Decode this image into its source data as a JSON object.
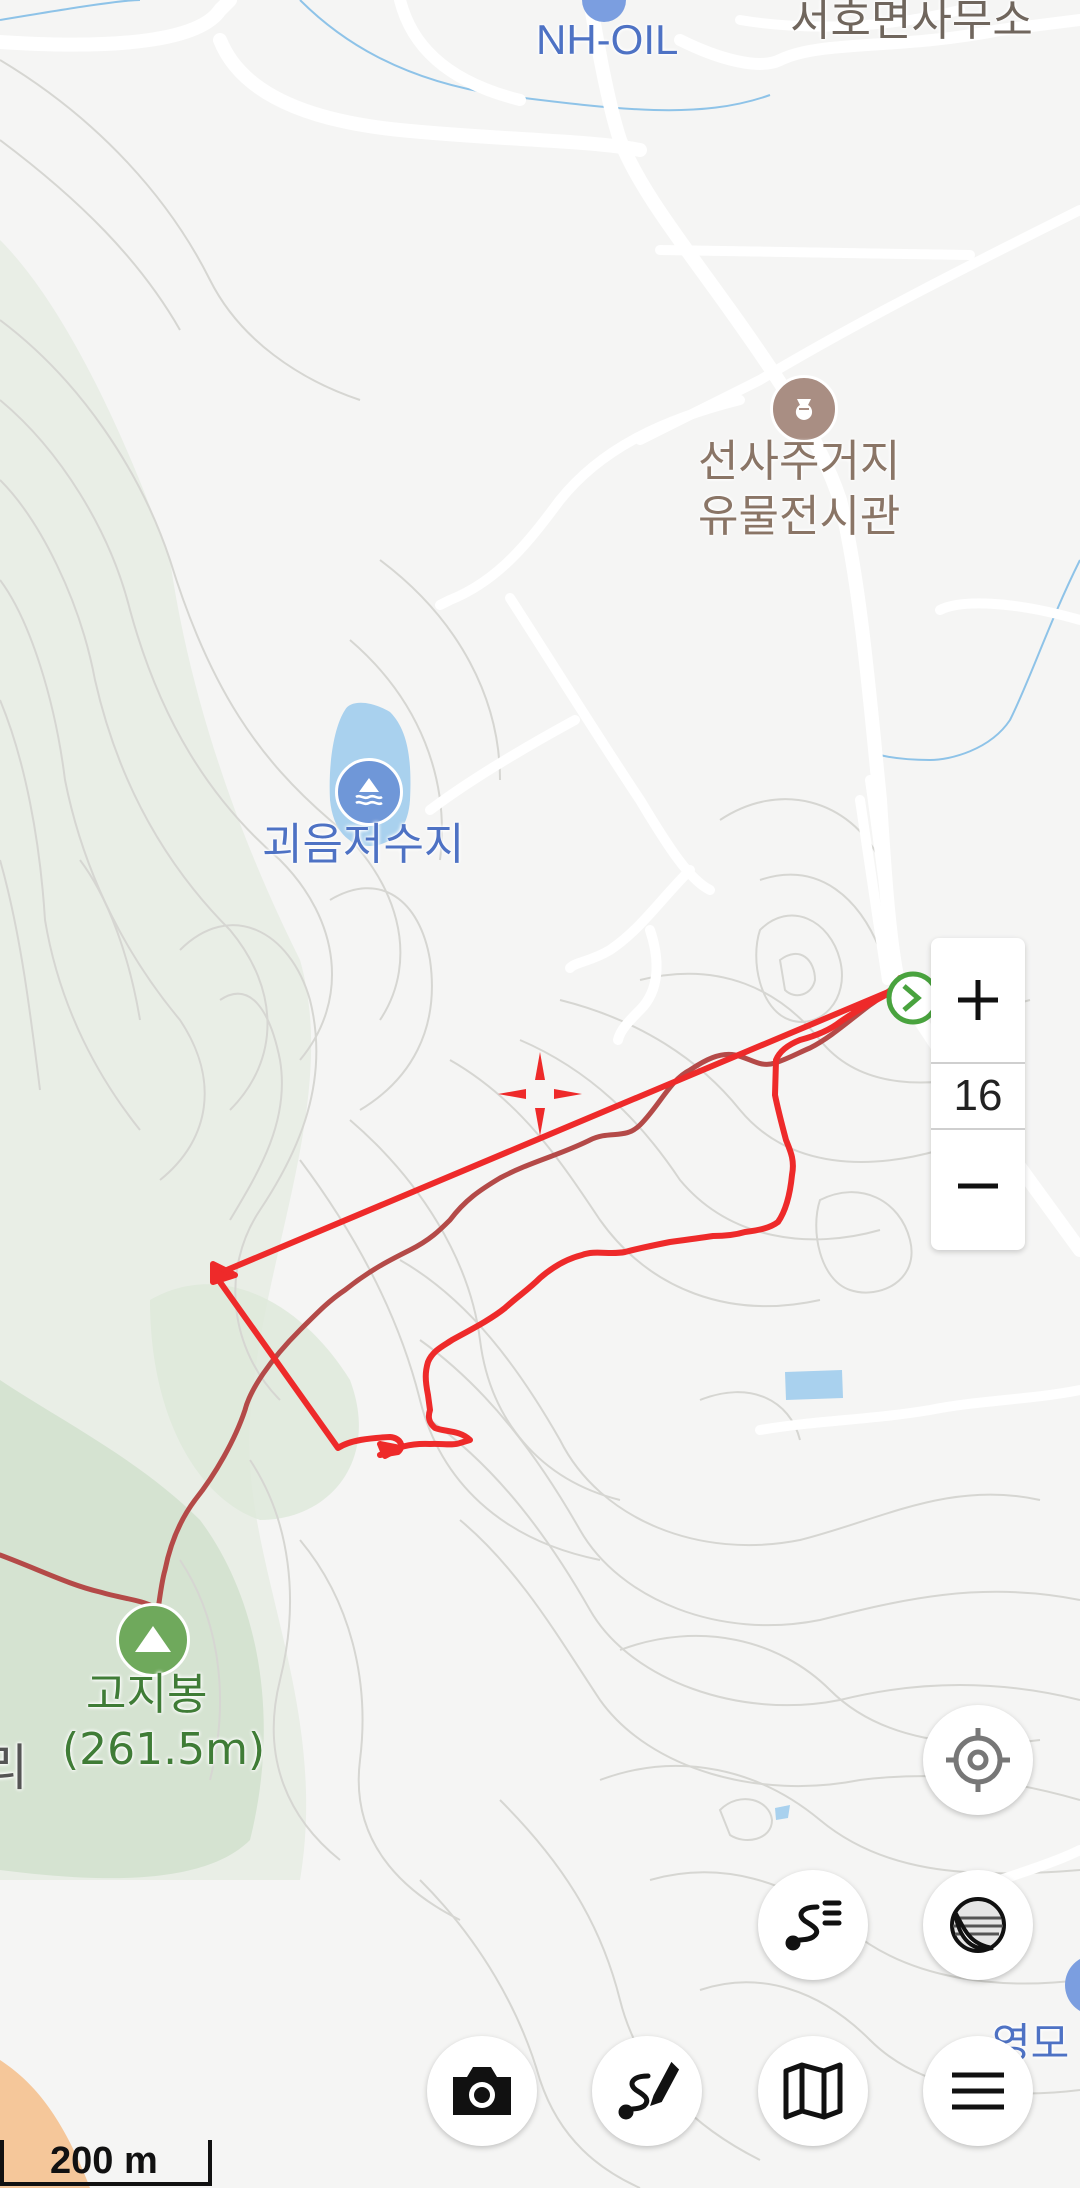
{
  "map": {
    "zoom_level": "16",
    "scale_label": "200 m",
    "route_color": "#ee2a2a",
    "trail_color": "#b44a48",
    "labels": {
      "gas_station": "NH-OIL",
      "town_office": "서호면사무소",
      "museum_line1": "선사주거지",
      "museum_line2": "유물전시관",
      "reservoir": "괴음저수지",
      "peak_name": "고지봉",
      "peak_elevation": "(261.5m)",
      "left_edge_partial": "리",
      "right_edge_partial": "영모"
    },
    "icons": {
      "museum": "museum-icon",
      "reservoir": "water-icon",
      "peak": "mountain-icon",
      "route_start": "start-marker-icon",
      "center": "crosshair-icon"
    }
  },
  "controls": {
    "zoom_in": "+",
    "zoom_out": "−",
    "buttons": [
      "my-location-button",
      "map-layer-button",
      "track-list-button",
      "camera-button",
      "route-edit-button",
      "map-select-button",
      "menu-button"
    ]
  }
}
